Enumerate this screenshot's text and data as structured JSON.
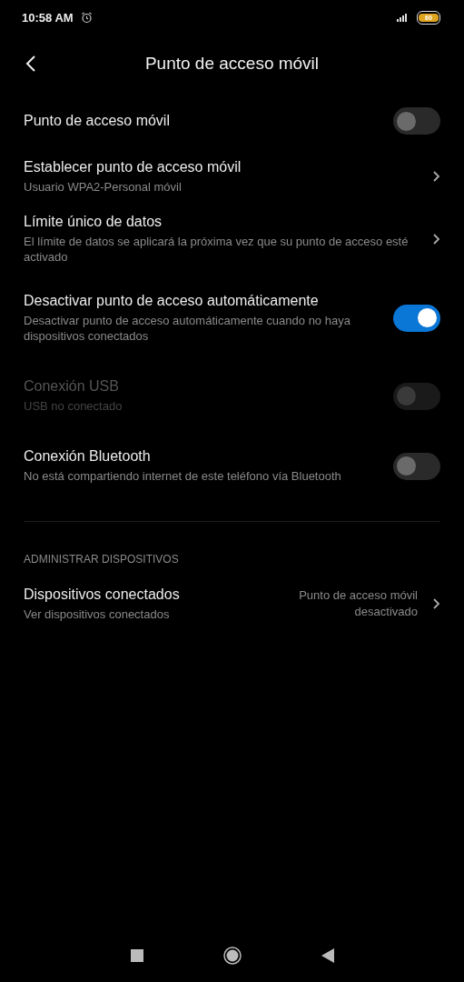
{
  "status_bar": {
    "time": "10:58 AM",
    "battery": "60"
  },
  "header": {
    "title": "Punto de acceso móvil"
  },
  "items": [
    {
      "kind": "toggle",
      "title": "Punto de acceso móvil",
      "on": false,
      "disabled": false
    },
    {
      "kind": "nav",
      "title": "Establecer punto de acceso móvil",
      "subtitle": "Usuario WPA2-Personal móvil"
    },
    {
      "kind": "nav",
      "title": "Límite único de datos",
      "subtitle": "El límite de datos se aplicará la próxima vez que su punto de acceso esté activado"
    },
    {
      "kind": "toggle",
      "title": "Desactivar punto de acceso automáticamente",
      "subtitle": "Desactivar punto de acceso automáticamente cuando no haya dispositivos conectados",
      "on": true,
      "disabled": false
    },
    {
      "kind": "toggle",
      "title": "Conexión USB",
      "subtitle": "USB no conectado",
      "on": false,
      "disabled": true
    },
    {
      "kind": "toggle",
      "title": "Conexión Bluetooth",
      "subtitle": "No está compartiendo internet de este teléfono vía Bluetooth",
      "on": false,
      "disabled": false
    }
  ],
  "section": {
    "header": "ADMINISTRAR DISPOSITIVOS",
    "items": [
      {
        "kind": "nav",
        "title": "Dispositivos conectados",
        "subtitle": "Ver dispositivos conectados",
        "value": "Punto de acceso móvil desactivado"
      }
    ]
  }
}
